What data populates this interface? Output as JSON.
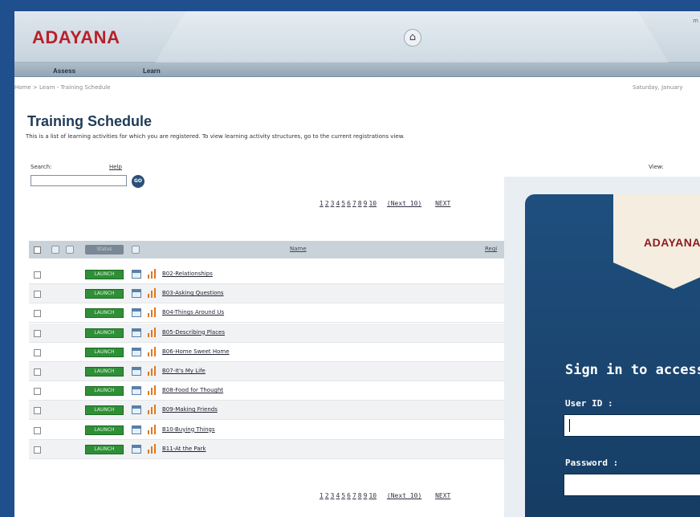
{
  "app": {
    "logo": "ADAYANA",
    "header_suffix": "m",
    "nav": [
      "Assess",
      "Learn"
    ],
    "breadcrumb": "Home > Learn - Training Schedule",
    "date": "Saturday, January"
  },
  "page": {
    "title": "Training Schedule",
    "description": "This is a list of learning activities for which you are registered. To view learning activity structures, go to the current registrations view.",
    "search_label": "Search:",
    "help_label": "Help",
    "go_label": "GO",
    "view_label": "View:"
  },
  "pager": {
    "pages": [
      "1",
      "2",
      "3",
      "4",
      "5",
      "6",
      "7",
      "8",
      "9",
      "10"
    ],
    "next10": "(Next 10)",
    "next": "NEXT"
  },
  "table": {
    "status_header": "Status",
    "name_header": "Name",
    "reg_header": "Regi",
    "launch_label": "LAUNCH",
    "rows": [
      "B02-Relationships",
      "B03-Asking Questions",
      "B04-Things Around Us",
      "B05-Describing Places",
      "B06-Home Sweet Home",
      "B07-It's My Life",
      "B08-Food for Thought",
      "B09-Making Friends",
      "B10-Buying Things",
      "B11-At the Park"
    ]
  },
  "login": {
    "logo": "ADAYANA",
    "heading": "Sign in to access",
    "user_label": "User ID :",
    "user_value": "",
    "password_label": "Password :",
    "password_value": ""
  },
  "colors": {
    "brand_red": "#b8202a",
    "frame_blue": "#1f4f8c",
    "launch_green": "#2f8f36",
    "login_blue": "#1f4f7e"
  }
}
